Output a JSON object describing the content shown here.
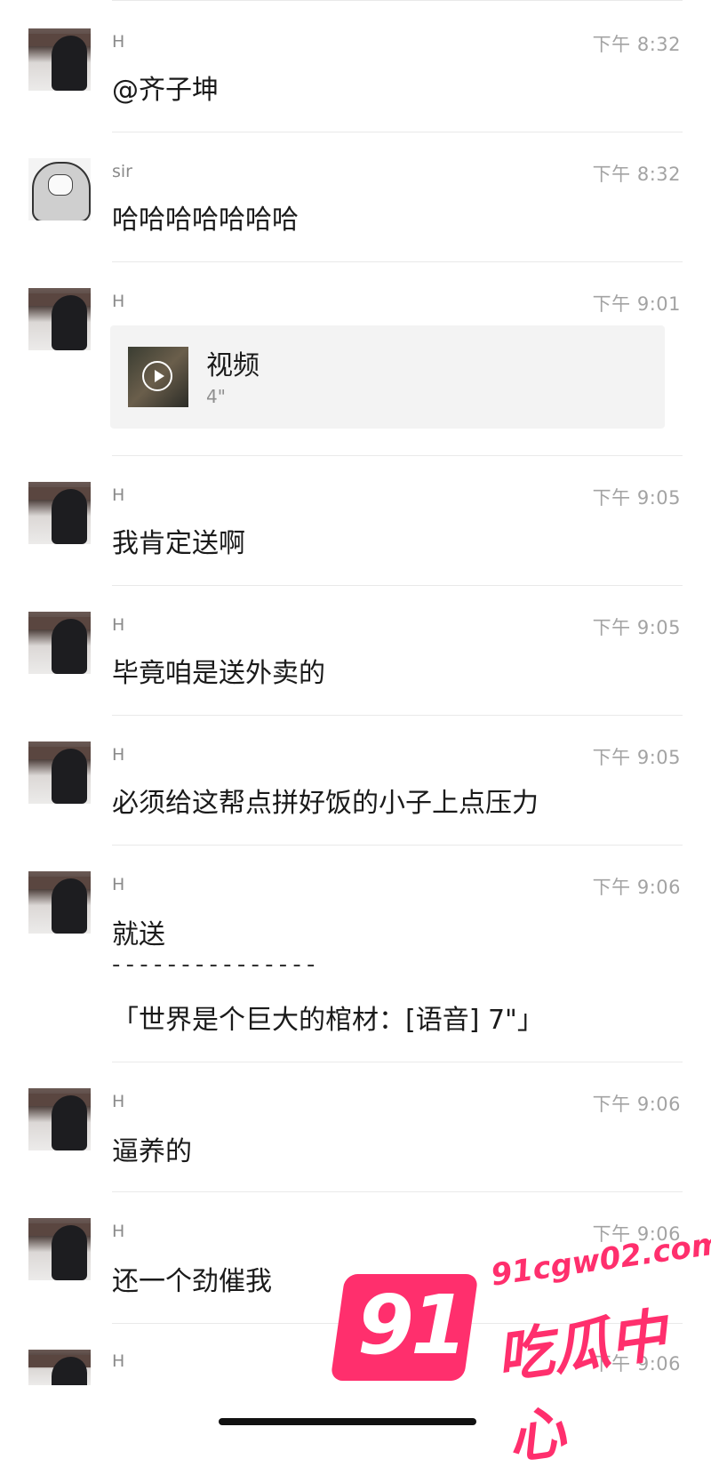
{
  "messages": [
    {
      "sender": "H",
      "time": "下午 8:32",
      "text": "@齐子坤"
    },
    {
      "sender": "sir",
      "time": "下午 8:32",
      "text": "哈哈哈哈哈哈哈"
    },
    {
      "sender": "H",
      "time": "下午 9:01",
      "video": {
        "title": "视频",
        "duration": "4\""
      }
    },
    {
      "sender": "H",
      "time": "下午 9:05",
      "text": "我肯定送啊"
    },
    {
      "sender": "H",
      "time": "下午 9:05",
      "text": "毕竟咱是送外卖的"
    },
    {
      "sender": "H",
      "time": "下午 9:05",
      "text": "必须给这帮点拼好饭的小子上点压力"
    },
    {
      "sender": "H",
      "time": "下午 9:06",
      "text": "就送",
      "quote_separator": "- - - - - - - - - - - - - - -",
      "quote": "「世界是个巨大的棺材：[语音] 7\"」"
    },
    {
      "sender": "H",
      "time": "下午 9:06",
      "text": "逼养的"
    },
    {
      "sender": "H",
      "time": "下午 9:06",
      "text": "还一个劲催我"
    },
    {
      "sender": "H",
      "time": "下午 9:06"
    }
  ],
  "watermark": {
    "badge": "91",
    "domain": "91cgw02.com",
    "name": "吃瓜中心",
    "color": "#ff2f6d"
  }
}
